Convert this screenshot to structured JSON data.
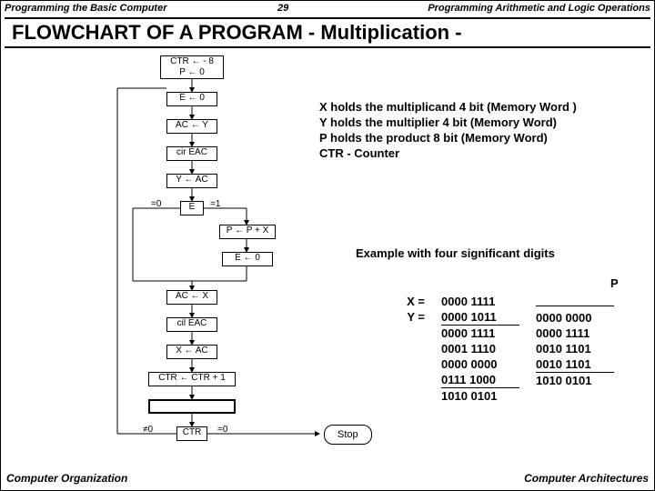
{
  "header": {
    "left": "Programming the Basic Computer",
    "page": "29",
    "right": "Programming Arithmetic and Logic Operations"
  },
  "title": "FLOWCHART  OF   A  PROGRAM  - Multiplication -",
  "footer": {
    "left": "Computer Organization",
    "right": "Computer Architectures"
  },
  "boxes": {
    "b1a": "CTR ← - 8",
    "b1b": "P ← 0",
    "b2": "E ← 0",
    "b3": "AC ← Y",
    "b4": "cir EAC",
    "b5": "Y ← AC",
    "b6": "E",
    "b6l": "=0",
    "b6r": "=1",
    "b7": "P ← P + X",
    "b8": "E ← 0",
    "b9": "AC ← X",
    "b10": "cil EAC",
    "b11": "X ← AC",
    "b12": "CTR ← CTR + 1",
    "b13": "CTR",
    "b13l": "≠0",
    "b13r": "=0",
    "stop": "Stop"
  },
  "desc": {
    "l1": "X holds the multiplicand 4 bit (Memory Word )",
    "l2": "Y holds the multiplier 4 bit (Memory Word)",
    "l3": "P holds the product 8 bit (Memory Word)",
    "l4": "CTR - Counter"
  },
  "example": {
    "title": "Example with four significant digits",
    "P": "P",
    "labels": "X =\nY =",
    "col1": "0000 1111\n0000 1011\n0000 1111\n0001 1110\n0000 0000\n0111 1000\n1010 0101",
    "col2": "0000 0000\n0000 1111\n0010 1101\n0010 1101\n1010 0101"
  }
}
